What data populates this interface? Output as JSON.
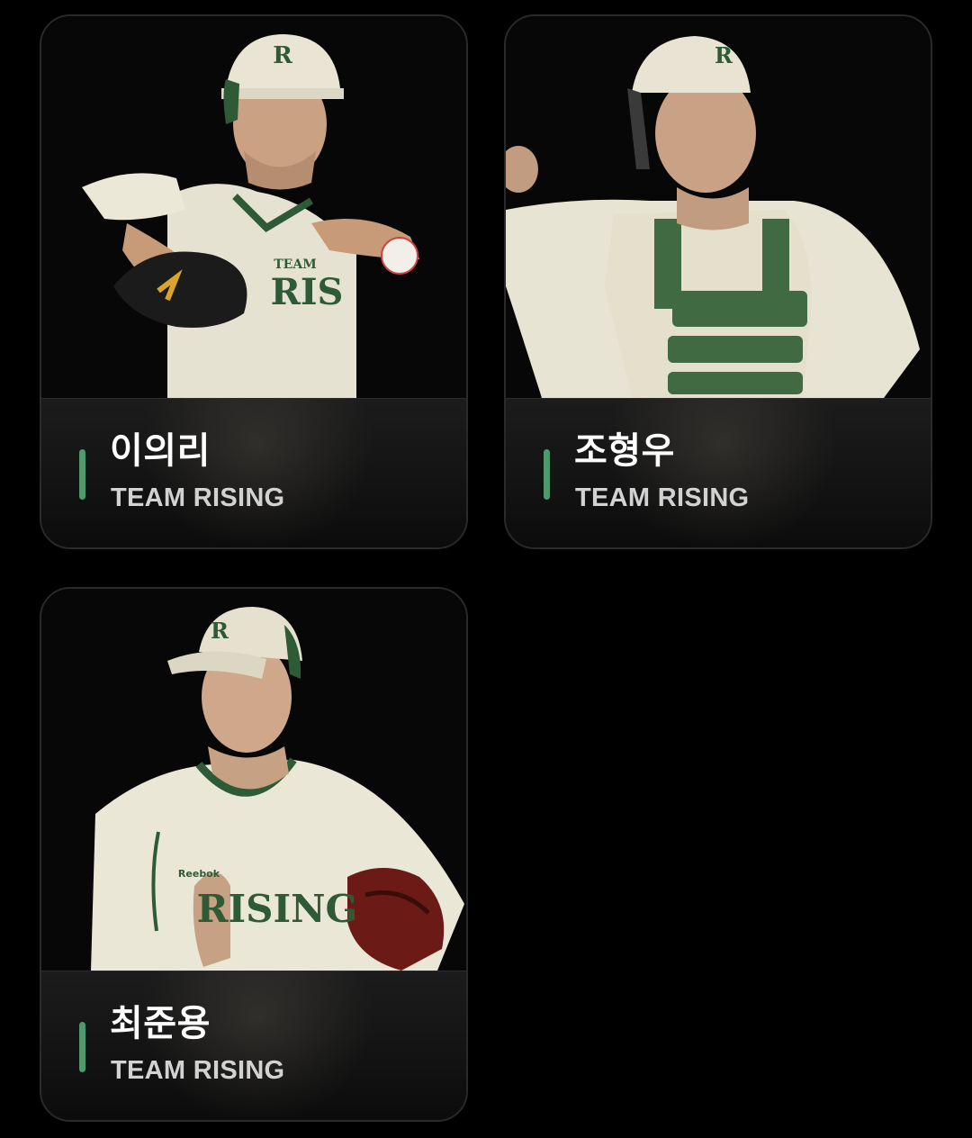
{
  "players": [
    {
      "name": "이의리",
      "team": "TEAM RISING",
      "photo_icon": "pitcher-photo"
    },
    {
      "name": "조형우",
      "team": "TEAM RISING",
      "photo_icon": "catcher-photo"
    },
    {
      "name": "최준용",
      "team": "TEAM RISING",
      "photo_icon": "fielder-photo"
    }
  ],
  "colors": {
    "accent": "#4e9a6c",
    "uniform_green": "#2f5a36",
    "uniform_cream": "#ece8d8",
    "background": "#000000"
  }
}
